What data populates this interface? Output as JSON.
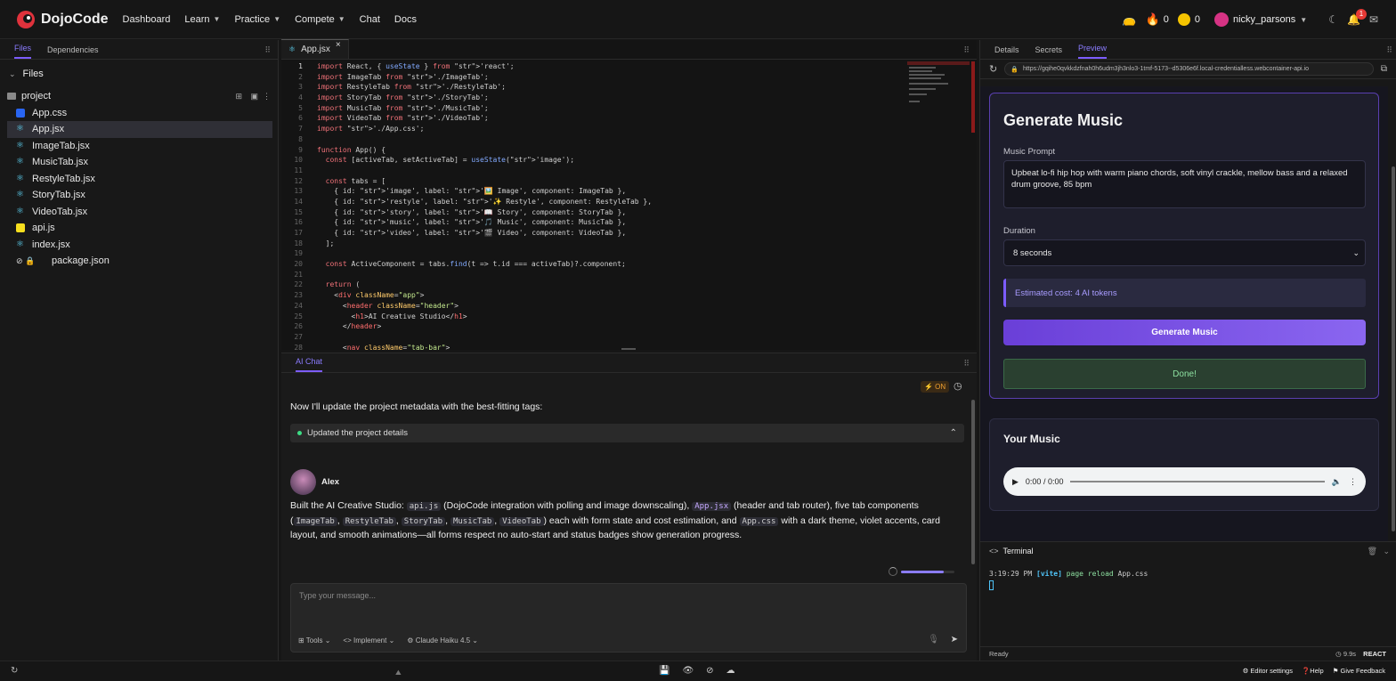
{
  "app": {
    "name": "DojoCode"
  },
  "nav": {
    "items": [
      {
        "label": "Dashboard",
        "dropdown": false
      },
      {
        "label": "Learn",
        "dropdown": true
      },
      {
        "label": "Practice",
        "dropdown": true
      },
      {
        "label": "Compete",
        "dropdown": true
      },
      {
        "label": "Chat",
        "dropdown": false
      },
      {
        "label": "Docs",
        "dropdown": false
      }
    ]
  },
  "user": {
    "streak": "0",
    "coins": "0",
    "name": "nicky_parsons",
    "notifications": "1"
  },
  "left_panel": {
    "tabs": [
      "Files",
      "Dependencies"
    ],
    "files_title": "Files",
    "folder": "project",
    "files": [
      {
        "name": "App.css",
        "type": "css"
      },
      {
        "name": "App.jsx",
        "type": "react",
        "selected": true
      },
      {
        "name": "ImageTab.jsx",
        "type": "react"
      },
      {
        "name": "MusicTab.jsx",
        "type": "react"
      },
      {
        "name": "RestyleTab.jsx",
        "type": "react"
      },
      {
        "name": "StoryTab.jsx",
        "type": "react"
      },
      {
        "name": "VideoTab.jsx",
        "type": "react"
      },
      {
        "name": "api.js",
        "type": "js"
      },
      {
        "name": "index.jsx",
        "type": "react"
      },
      {
        "name": "package.json",
        "type": "json-locked"
      }
    ]
  },
  "editor": {
    "tab": "App.jsx",
    "lines": [
      "import React, { useState } from 'react';",
      "import ImageTab from './ImageTab';",
      "import RestyleTab from './RestyleTab';",
      "import StoryTab from './StoryTab';",
      "import MusicTab from './MusicTab';",
      "import VideoTab from './VideoTab';",
      "import './App.css';",
      "",
      "function App() {",
      "  const [activeTab, setActiveTab] = useState('image');",
      "",
      "  const tabs = [",
      "    { id: 'image', label: '🖼️ Image', component: ImageTab },",
      "    { id: 'restyle', label: '✨ Restyle', component: RestyleTab },",
      "    { id: 'story', label: '📖 Story', component: StoryTab },",
      "    { id: 'music', label: '🎵 Music', component: MusicTab },",
      "    { id: 'video', label: '🎬 Video', component: VideoTab },",
      "  ];",
      "",
      "  const ActiveComponent = tabs.find(t => t.id === activeTab)?.component;",
      "",
      "  return (",
      "    <div className=\"app\">",
      "      <header className=\"header\">",
      "        <h1>AI Creative Studio</h1>",
      "      </header>",
      "",
      "      <nav className=\"tab-bar\">"
    ]
  },
  "chat": {
    "tab": "AI Chat",
    "on_badge": "⚡ ON",
    "intro": "Now I'll update the project metadata with the best-fitting tags:",
    "status": "Updated the project details",
    "author": "Alex",
    "message": {
      "p1": "Built the AI Creative Studio: ",
      "c1": "api.js",
      "p2": " (DojoCode integration with polling and image downscaling), ",
      "c2": "App.jsx",
      "p3": " (header and tab router), five tab components (",
      "c3": "ImageTab",
      "c4": "RestyleTab",
      "c5": "StoryTab",
      "c6": "MusicTab",
      "c7": "VideoTab",
      "p4": ") each with form state and cost estimation, and ",
      "c8": "App.css",
      "p5": " with a dark theme, violet accents, card layout, and smooth animations—all forms respect no auto-start and status badges show generation progress.",
      "sep": ", "
    },
    "input_placeholder": "Type your message...",
    "tools_label": "Tools",
    "implement_label": "Implement",
    "model_label": "Claude Haiku 4.5"
  },
  "right_panel": {
    "tabs": [
      "Details",
      "Secrets",
      "Preview"
    ],
    "url": "https://gqihe0qvkkdzfnah0h6udm3jh3nlo3-1tmf-5173--d5306e6f.local-credentialless.webcontainer-api.io",
    "generate": {
      "title": "Generate Music",
      "prompt_label": "Music Prompt",
      "prompt_value": "Upbeat lo-fi hip hop with warm piano chords, soft vinyl crackle, mellow bass and a relaxed drum groove, 85 bpm",
      "duration_label": "Duration",
      "duration_value": "8 seconds",
      "cost": "Estimated cost: 4 AI tokens",
      "button": "Generate Music",
      "done": "Done!"
    },
    "music": {
      "title": "Your Music",
      "time": "0:00 / 0:00"
    },
    "terminal": {
      "title": "Terminal",
      "time": "3:19:29 PM",
      "tag": "[vite]",
      "msg1": "page reload",
      "file": "App.css"
    },
    "status": {
      "ready": "Ready",
      "timer": "9.9s",
      "framework": "REACT"
    }
  },
  "bottom": {
    "editor_settings": "Editor settings",
    "help": "Help",
    "feedback": "Give Feedback"
  },
  "colors": {
    "accent": "#7c5cff",
    "success": "#2e4a36",
    "bg": "#161616"
  }
}
